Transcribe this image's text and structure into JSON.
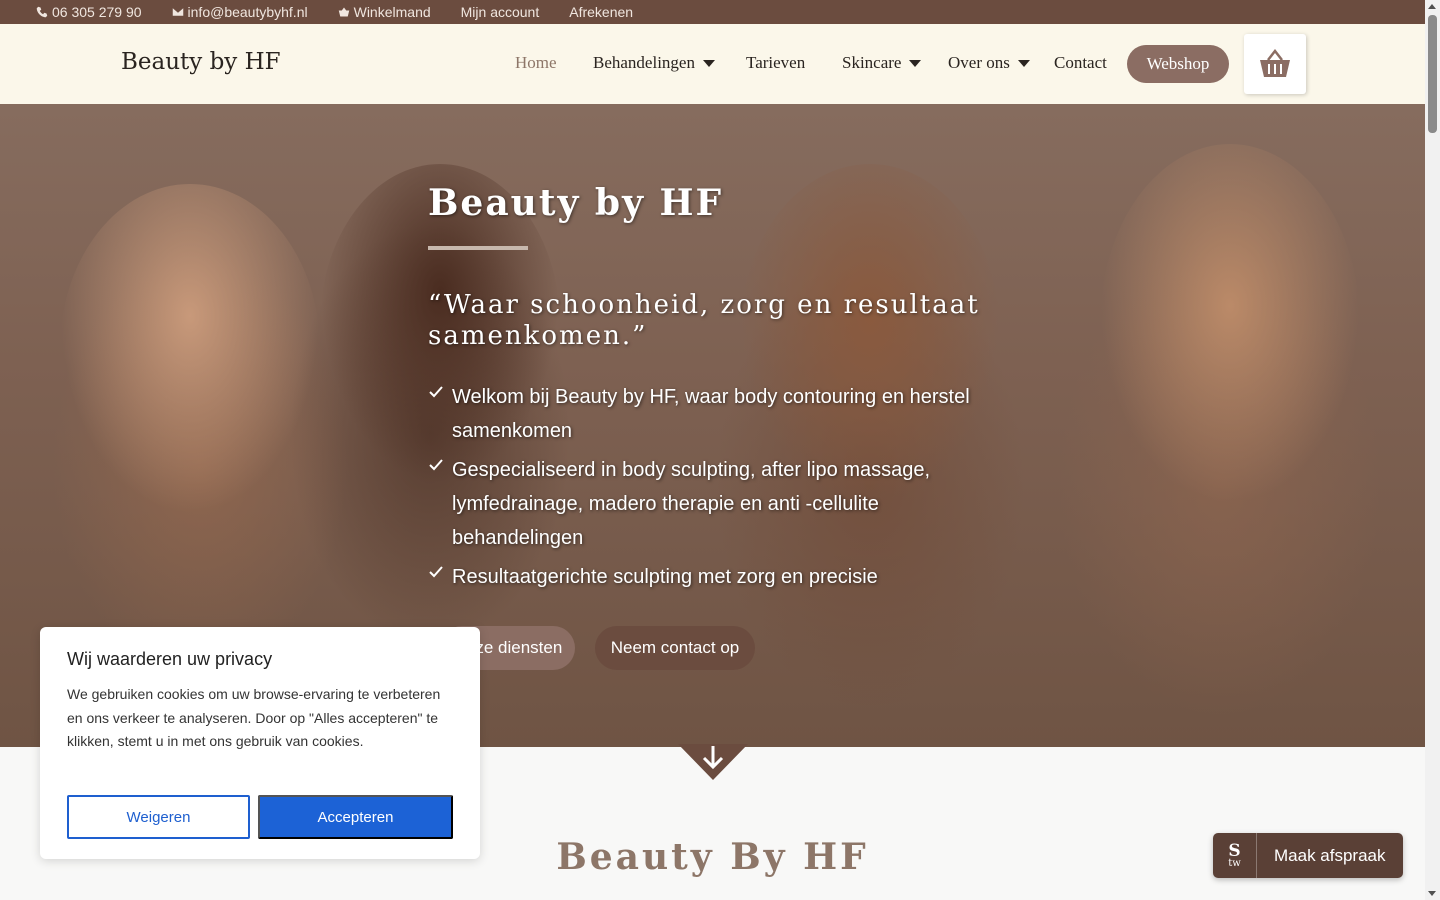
{
  "topbar": {
    "phone": "06 305 279 90",
    "email": "info@beautybyhf.nl",
    "cart": "Winkelmand",
    "account": "Mijn account",
    "checkout": "Afrekenen"
  },
  "header": {
    "logo": "Beauty by HF",
    "nav": {
      "home": "Home",
      "treatments": "Behandelingen",
      "prices": "Tarieven",
      "skincare": "Skincare",
      "about": "Over ons",
      "contact": "Contact"
    },
    "webshop": "Webshop",
    "cart_icon": "basket-icon"
  },
  "hero": {
    "title": "Beauty by HF",
    "quote": "“Waar schoonheid, zorg en resultaat samenkomen.”",
    "bullets": [
      "Welkom bij Beauty by HF, waar body contouring en herstel samenkomen",
      "Gespecialiseerd in body sculpting, after lipo massage, lymfedrainage, madero therapie en anti -cellulite behandelingen",
      "Resultaatgerichte sculpting met zorg en precisie"
    ],
    "btn_services": "Onze diensten",
    "btn_contact": "Neem contact op"
  },
  "section": {
    "title": "Beauty By HF"
  },
  "cookie": {
    "title": "Wij waarderen uw privacy",
    "text": "We gebruiken cookies om uw browse-ervaring te verbeteren en ons verkeer te analyseren. Door op \"Alles accepteren\" te klikken, stemt u in met ons gebruik van cookies.",
    "reject": "Weigeren",
    "accept": "Accepteren"
  },
  "booking": {
    "logo_s": "S",
    "logo_tw": "tw",
    "label": "Maak afspraak"
  },
  "colors": {
    "topbar": "#6b4c3f",
    "header_bg": "#fbf7ea",
    "accent": "#8b6d63",
    "accept": "#1c62d6"
  }
}
